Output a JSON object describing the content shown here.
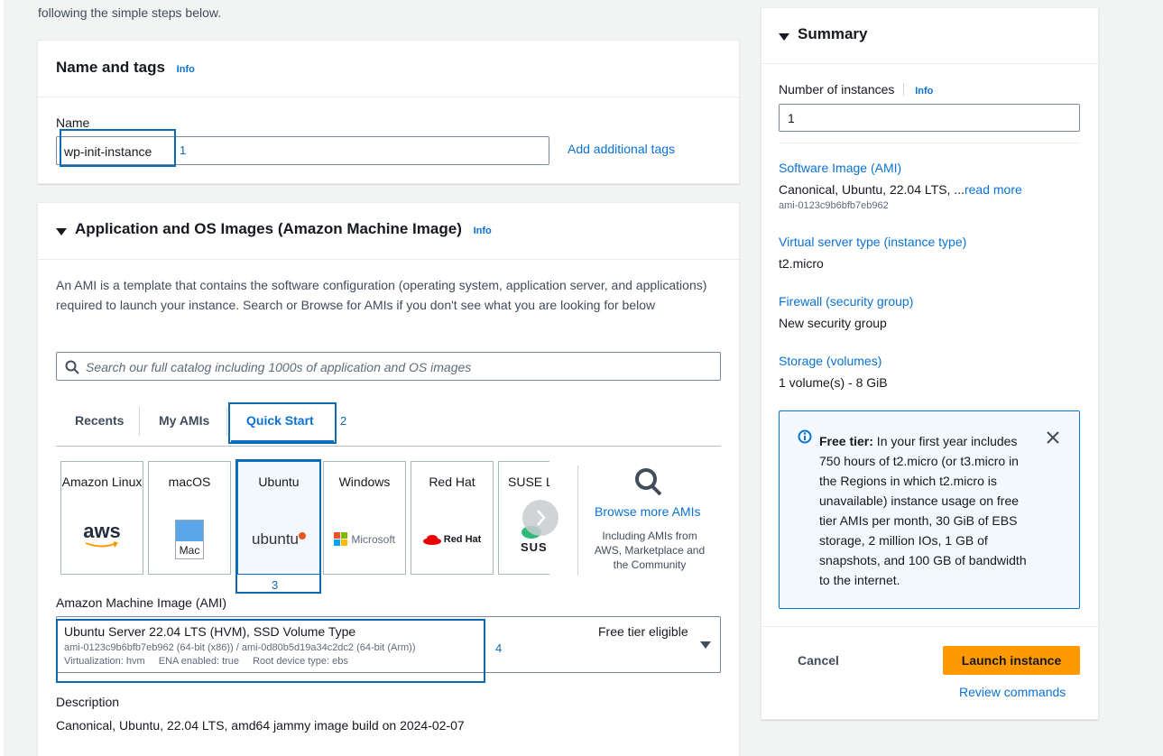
{
  "intro_text": "following the simple steps below.",
  "name_tags": {
    "title": "Name and tags",
    "info": "Info",
    "name_label": "Name",
    "name_value": "wp-init-instance",
    "add_tags": "Add additional tags",
    "step": "1"
  },
  "ami_section": {
    "title": "Application and OS Images (Amazon Machine Image)",
    "info": "Info",
    "description": "An AMI is a template that contains the software configuration (operating system, application server, and applications) required to launch your instance. Search or Browse for AMIs if you don't see what you are looking for below",
    "search_placeholder": "Search our full catalog including 1000s of application and OS images",
    "tabs": [
      "Recents",
      "My AMIs",
      "Quick Start"
    ],
    "tab_step": "2",
    "cards": [
      {
        "label": "Amazon Linux",
        "logo": "aws"
      },
      {
        "label": "macOS",
        "logo": "Mac"
      },
      {
        "label": "Ubuntu",
        "logo": "ubuntu"
      },
      {
        "label": "Windows",
        "logo": "Microsoft"
      },
      {
        "label": "Red Hat",
        "logo": "Red Hat"
      },
      {
        "label": "SUSE Li",
        "logo": "SUS"
      }
    ],
    "card_step": "3",
    "browse": {
      "title": "Browse more AMIs",
      "subtitle": "Including AMIs from AWS, Marketplace and the Community"
    },
    "ami_label": "Amazon Machine Image (AMI)",
    "selected": {
      "name": "Ubuntu Server 22.04 LTS (HVM), SSD Volume Type",
      "ids": "ami-0123c9b6bfb7eb962 (64-bit (x86)) / ami-0d80b5d19a34c2dc2 (64-bit (Arm))",
      "virt": "Virtualization: hvm",
      "ena": "ENA enabled: true",
      "root": "Root device type: ebs",
      "free_tier": "Free tier eligible",
      "step": "4"
    },
    "desc_label": "Description",
    "desc_value": "Canonical, Ubuntu, 22.04 LTS, amd64 jammy image build on 2024-02-07"
  },
  "summary": {
    "title": "Summary",
    "instances_label": "Number of instances",
    "info": "Info",
    "instances_value": "1",
    "software_label": "Software Image (AMI)",
    "software_value": "Canonical, Ubuntu, 22.04 LTS, ...",
    "read_more": "read more",
    "software_id": "ami-0123c9b6bfb7eb962",
    "type_label": "Virtual server type (instance type)",
    "type_value": "t2.micro",
    "firewall_label": "Firewall (security group)",
    "firewall_value": "New security group",
    "storage_label": "Storage (volumes)",
    "storage_value": "1 volume(s) - 8 GiB",
    "free_tier_bold": "Free tier:",
    "free_tier_text": " In your first year includes 750 hours of t2.micro (or t3.micro in the Regions in which t2.micro is unavailable) instance usage on free tier AMIs per month, 30 GiB of EBS storage, 2 million IOs, 1 GB of snapshots, and 100 GB of bandwidth to the internet.",
    "cancel": "Cancel",
    "launch": "Launch instance",
    "review": "Review commands"
  },
  "colors": {
    "accent": "#0972d3",
    "launch": "#ff9900",
    "step_box": "#0b6ab0",
    "info_box_bg": "#f2f8fd"
  }
}
